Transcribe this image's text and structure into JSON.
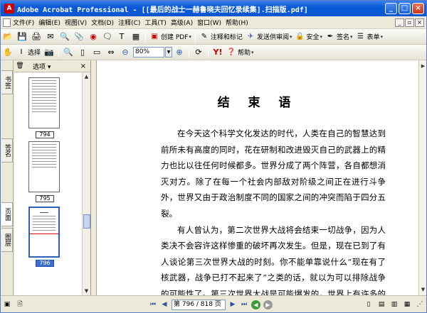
{
  "window": {
    "title": "Adobe Acrobat Professional - [[最后的战士一赫鲁晓夫回忆录续集].扫描版.pdf]",
    "app_badge": "A",
    "controls": {
      "minimize": "_",
      "maximize": "□",
      "close": "×"
    },
    "inner_controls": {
      "minimize": "_",
      "restore": "▫",
      "close": "×"
    }
  },
  "menu": {
    "items": [
      "文件(F)",
      "编辑(E)",
      "视图(V)",
      "文档(D)",
      "注释(C)",
      "工具(T)",
      "高级(A)",
      "窗口(W)",
      "帮助(H)"
    ]
  },
  "toolbar1": {
    "create_pdf": "创建 PDF",
    "comment_markup": "注释和标记",
    "send_review": "发送供审阅",
    "security": "安全",
    "sign": "签名",
    "forms": "表单"
  },
  "toolbar2": {
    "select": "选择",
    "zoom_value": "80%",
    "help": "帮助"
  },
  "sidebar": {
    "tabs": [
      "书签",
      "签名",
      "页面",
      "图层"
    ],
    "pane_options": "选项",
    "pages": [
      "794",
      "795",
      "796"
    ],
    "selected_page": "796"
  },
  "document": {
    "title": "结 束 语",
    "paragraphs": [
      "在今天这个科学文化发达的时代，人类在自己的智慧达到前所未有高度的同时，花在研制和改进毁灭自己的武器上的精力也比以往任何时候都多。世界分成了两个阵营，各自都想消灭对方。除了在每一个社会内部敌对阶级之间正在进行斗争外，世界又由于政治制度不同的国家之间的冲突而陷于四分五裂。",
      "有人曾认为，第二次世界大战将会结束一切战争，因为人类决不会容许这样惨重的破坏再次发生。但是，现在已到了有人谈论第三次世界大战的时刻。你不能单靠说什么“现在有了核武器，战争已打不起来了”之类的话，就以为可以排除战争的可能性了。第三次世界大战是可能爆发的，世界上有许多的祸根发动世界大战的疯子。"
    ]
  },
  "statusbar": {
    "page_display": "第 796 / 818 页"
  },
  "colors": {
    "titlebar": "#0a5bd9",
    "selection": "#3a6ecf",
    "chrome": "#ece9d8"
  }
}
